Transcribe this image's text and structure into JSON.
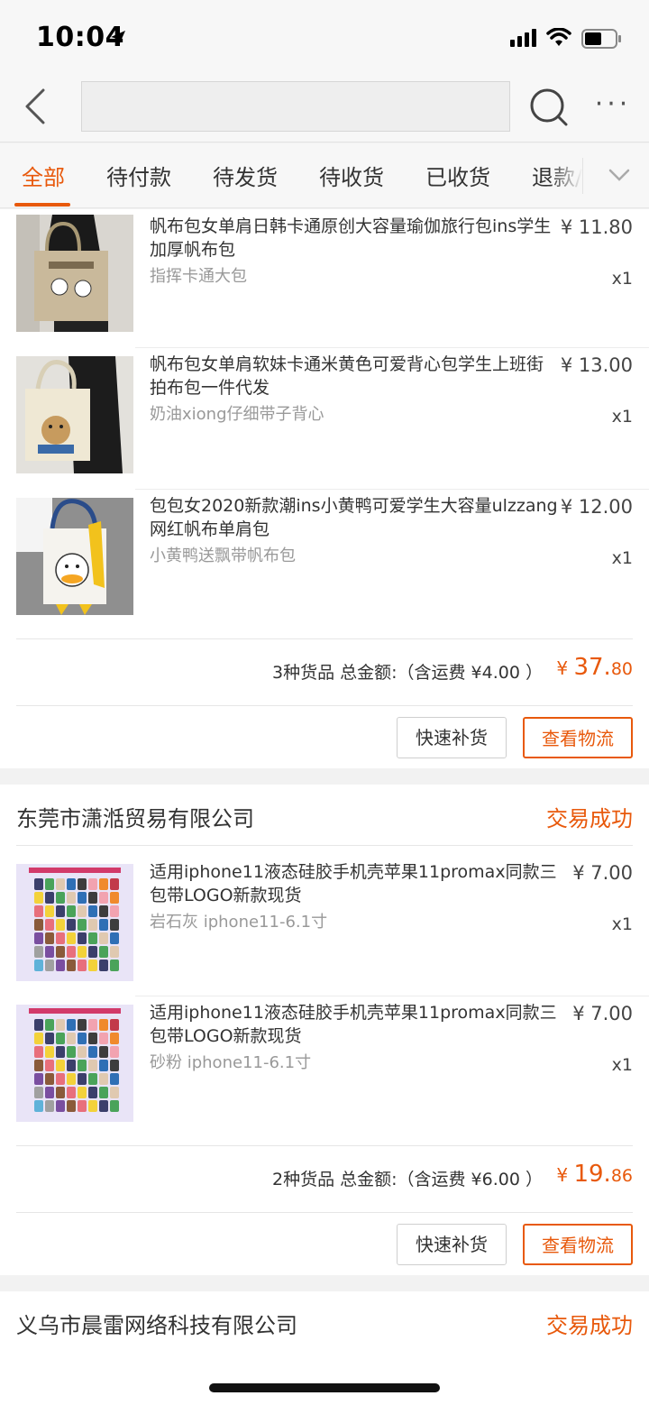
{
  "status_bar": {
    "time": "10:04"
  },
  "nav": {
    "back_icon": "chevron-left-icon",
    "search_placeholder": "",
    "search_icon": "search-icon",
    "more_label": "···"
  },
  "tabs": {
    "items": [
      {
        "label": "全部",
        "active": true
      },
      {
        "label": "待付款",
        "active": false
      },
      {
        "label": "待发货",
        "active": false
      },
      {
        "label": "待收货",
        "active": false
      },
      {
        "label": "已收货",
        "active": false
      },
      {
        "label": "退款/",
        "active": false
      }
    ],
    "expand_icon": "chevron-down-icon"
  },
  "orders": [
    {
      "items": [
        {
          "title": "帆布包女单肩日韩卡通原创大容量瑜伽旅行包ins学生加厚帆布包",
          "sku": "指挥卡通大包",
          "price": "¥ 11.80",
          "qty": "x1"
        },
        {
          "title": "帆布包女单肩软妹卡通米黄色可爱背心包学生上班街拍布包一件代发",
          "sku": "奶油xiong仔细带子背心",
          "price": "¥ 13.00",
          "qty": "x1"
        },
        {
          "title": "包包女2020新款潮ins小黄鸭可爱学生大容量ulzzang网红帆布单肩包",
          "sku": "小黄鸭送飘带帆布包",
          "price": "¥ 12.00",
          "qty": "x1"
        }
      ],
      "summary": "3种货品 总金额:（含运费 ¥4.00 ）",
      "total_yen": "¥ ",
      "total_int": "37.",
      "total_dec": "80",
      "btn_restock": "快速补货",
      "btn_logistics": "查看物流"
    },
    {
      "shop": "东莞市潇湉贸易有限公司",
      "status": "交易成功",
      "items": [
        {
          "title": "适用iphone11液态硅胶手机壳苹果11promax同款三包带LOGO新款现货",
          "sku": "岩石灰 iphone11-6.1寸",
          "price": "¥ 7.00",
          "qty": "x1"
        },
        {
          "title": "适用iphone11液态硅胶手机壳苹果11promax同款三包带LOGO新款现货",
          "sku": "砂粉 iphone11-6.1寸",
          "price": "¥ 7.00",
          "qty": "x1"
        }
      ],
      "summary": "2种货品 总金额:（含运费 ¥6.00 ）",
      "total_yen": "¥ ",
      "total_int": "19.",
      "total_dec": "86",
      "btn_restock": "快速补货",
      "btn_logistics": "查看物流"
    },
    {
      "shop": "义乌市晨雷网络科技有限公司",
      "status": "交易成功"
    }
  ],
  "colors": {
    "accent": "#e8590c",
    "muted": "#999999",
    "bg": "#f2f2f2"
  }
}
